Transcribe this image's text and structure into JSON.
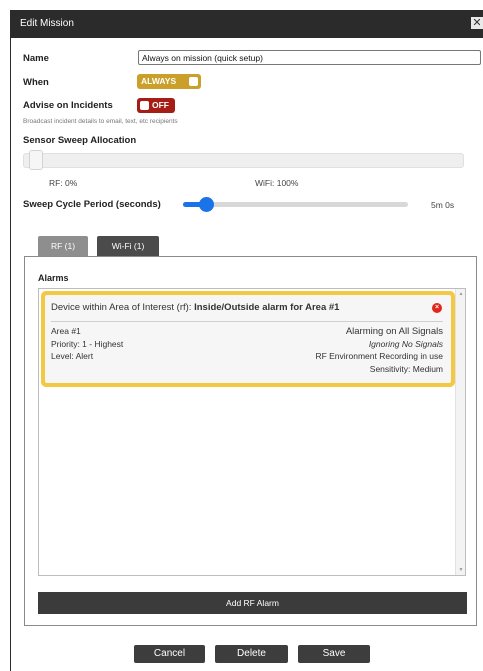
{
  "window": {
    "title": "Edit Mission",
    "close_glyph": "✕"
  },
  "form": {
    "name_label": "Name",
    "name_value": "Always on mission (quick setup)",
    "when_label": "When",
    "when_toggle": "ALWAYS",
    "advise_label": "Advise on Incidents",
    "advise_toggle": "OFF",
    "advise_subtext": "Broadcast incident details to email, text, etc recipients",
    "sweep_label": "Sensor Sweep Allocation",
    "sweep_rf_text": "RF: 0%",
    "sweep_wifi_text": "WiFi: 100%",
    "sweep_rf_percent": 0,
    "cycle_label": "Sweep Cycle Period (seconds)",
    "cycle_value_text": "5m 0s",
    "cycle_fraction": 0.1
  },
  "tabs": [
    {
      "label": "RF (1)",
      "active": false
    },
    {
      "label": "Wi-Fi (1)",
      "active": true
    }
  ],
  "alarms": {
    "heading": "Alarms",
    "card": {
      "title_prefix": "Device within Area of Interest (rf): ",
      "title_bold": "Inside/Outside alarm for Area #1",
      "delete_glyph": "×",
      "left": [
        "Area #1",
        "Priority: 1 - Highest",
        "Level: Alert"
      ],
      "right": [
        "Alarming on All Signals",
        "Ignoring No Signals",
        "RF Environment Recording in use",
        "Sensitivity: Medium"
      ]
    },
    "add_button": "Add RF Alarm"
  },
  "footer": {
    "cancel": "Cancel",
    "delete": "Delete",
    "save": "Save"
  },
  "colors": {
    "titlebar": "#2b2b2b",
    "always_toggle": "#caa02a",
    "off_toggle": "#a51d14",
    "slider_accent": "#1a73e8",
    "card_border": "#f3c842",
    "delete_icon": "#e4251b"
  },
  "icons": {
    "close": "close-icon",
    "delete": "delete-circle-icon",
    "scroll_up": "chevron-up-icon",
    "scroll_down": "chevron-down-icon"
  }
}
